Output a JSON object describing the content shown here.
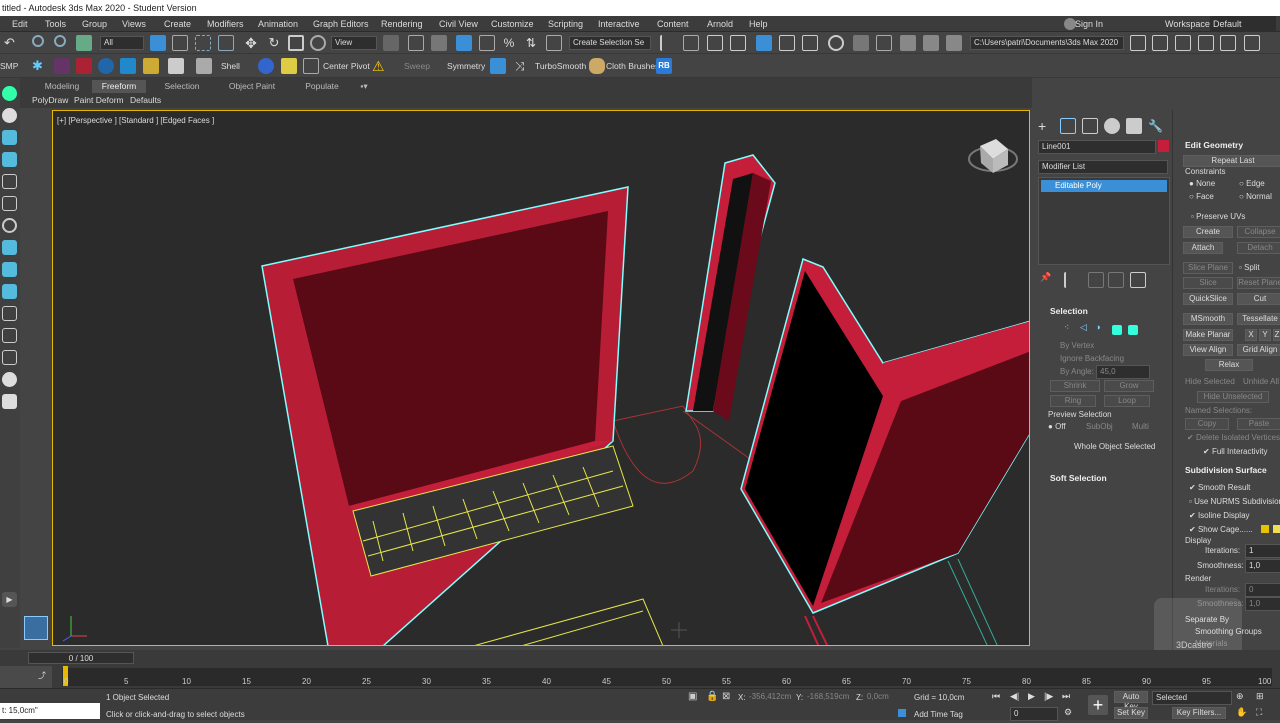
{
  "title": "titled - Autodesk 3ds Max 2020 - Student Version",
  "menu": [
    "Edit",
    "Tools",
    "Group",
    "Views",
    "Create",
    "Modifiers",
    "Animation",
    "Graph Editors",
    "Rendering",
    "Civil View",
    "Customize",
    "Scripting",
    "Interactive",
    "Content",
    "Arnold",
    "Help"
  ],
  "signin": "Sign In",
  "workspaces_label": "Workspaces:",
  "workspaces_value": "Default",
  "toolbar": {
    "filter": "All",
    "view": "View",
    "selection_set": "Create Selection Se",
    "path": "C:\\Users\\patri\\Documents\\3ds Max 2020"
  },
  "toolbar2": {
    "smp": "SMP",
    "shell": "Shell",
    "center_pivot": "Center Pivot",
    "sweep": "Sweep",
    "symmetry": "Symmetry",
    "turbosmooth": "TurboSmooth",
    "cloth_brushes": "Cloth Brushes",
    "rb": "RB"
  },
  "ribbon": {
    "tabs": [
      "Modeling",
      "Freeform",
      "Selection",
      "Object Paint",
      "Populate"
    ],
    "active": "Freeform",
    "subtabs": [
      "PolyDraw",
      "Paint Deform",
      "Defaults"
    ]
  },
  "viewport": {
    "label": "[+] [Perspective ] [Standard ] [Edged Faces ]"
  },
  "command_panel": {
    "object_name": "Line001",
    "modifier_list": "Modifier List",
    "stack_item": "Editable Poly",
    "selection_header": "Selection",
    "by_vertex": "By Vertex",
    "ignore_backfacing": "Ignore Backfacing",
    "by_angle": "By Angle:",
    "by_angle_value": "45,0",
    "shrink": "Shrink",
    "grow": "Grow",
    "ring": "Ring",
    "loop": "Loop",
    "preview_selection": "Preview Selection",
    "off": "Off",
    "subobj": "SubObj",
    "multi": "Multi",
    "whole_object": "Whole Object Selected",
    "soft_selection": "Soft Selection"
  },
  "edit_geometry": {
    "header": "Edit Geometry",
    "repeat_last": "Repeat Last",
    "constraints": "Constraints",
    "none": "None",
    "edge": "Edge",
    "face": "Face",
    "normal": "Normal",
    "preserve_uvs": "Preserve UVs",
    "create": "Create",
    "collapse": "Collapse",
    "attach": "Attach",
    "detach": "Detach",
    "slice_plane": "Slice Plane",
    "split": "Split",
    "slice": "Slice",
    "reset_plane": "Reset Plane",
    "quickslice": "QuickSlice",
    "cut": "Cut",
    "msmooth": "MSmooth",
    "tessellate": "Tessellate",
    "make_planar": "Make Planar",
    "x": "X",
    "y": "Y",
    "z": "Z",
    "view_align": "View Align",
    "grid_align": "Grid Align",
    "relax": "Relax",
    "hide_selected": "Hide Selected",
    "unhide_all": "Unhide All",
    "hide_unselected": "Hide Unselected",
    "named_selections": "Named Selections:",
    "copy": "Copy",
    "paste": "Paste",
    "delete_isolated": "Delete Isolated Vertices",
    "full_interactivity": "Full Interactivity"
  },
  "subdivision": {
    "header": "Subdivision Surface",
    "smooth_result": "Smooth Result",
    "use_nurms": "Use NURMS Subdivision",
    "isoline": "Isoline Display",
    "show_cage": "Show Cage......",
    "display": "Display",
    "iterations": "Iterations:",
    "iterations_value": "1",
    "smoothness": "Smoothness:",
    "smoothness_value": "1,0",
    "render": "Render",
    "r_iterations_value": "0",
    "r_smoothness_value": "1,0",
    "separate_by": "Separate By",
    "smoothing_groups": "Smoothing Groups",
    "materials": "Materials"
  },
  "watermark": "3Dcastro",
  "timeline": {
    "frame": "0 / 100",
    "ticks": [
      "0",
      "5",
      "10",
      "15",
      "20",
      "25",
      "30",
      "35",
      "40",
      "45",
      "50",
      "55",
      "60",
      "65",
      "70",
      "75",
      "80",
      "85",
      "90",
      "95",
      "100"
    ]
  },
  "status": {
    "left_value": "t:  15,0cm\"",
    "selected": "1 Object Selected",
    "prompt": "Click or click-and-drag to select objects",
    "x_label": "X:",
    "x": "-356,412cm",
    "y_label": "Y:",
    "y": "-168,519cm",
    "z_label": "Z:",
    "z": "0,0cm",
    "grid": "Grid = 10,0cm",
    "add_time_tag": "Add Time Tag",
    "auto_key": "Auto Key",
    "selected_dd": "Selected",
    "set_key": "Set Key",
    "key_filters": "Key Filters...",
    "frame_value": "0"
  },
  "colors": {
    "accent_blue": "#3a8fd6",
    "wall_red": "#c41e3a",
    "selection_cyan": "#7fffff",
    "active_yellow": "#e6b800"
  }
}
